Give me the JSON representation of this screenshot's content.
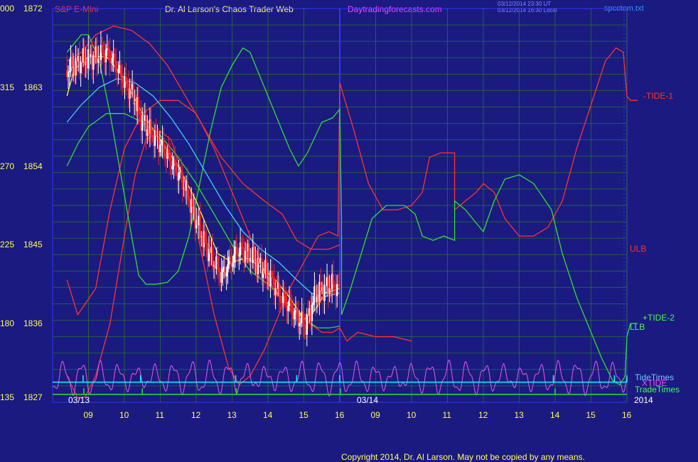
{
  "header": {
    "symbol": "S&P E-Mini",
    "title": "Dr. Al Larson's Chaos Trader Web",
    "site": "Daytradingforecasts.com",
    "timestamp1": "03/12/2014 23:30 UT",
    "timestamp2": "03/12/2014 16:30 Local",
    "filename": "spcctem.txt"
  },
  "copyright": "Copyright 2014, Dr. Al Larson. May not be copied by any means.",
  "colors": {
    "background": "#1a1a80",
    "grid": "#2b7a2b",
    "price_up": "#ffffff",
    "price_down": "#ff2020",
    "tide_red": "#ff3333",
    "tide_green": "#33dd33",
    "ema_cyan": "#44ccff",
    "ema_yellow": "#ffff44",
    "magenta": "#ee55ee",
    "tide_times": "#00ffff",
    "trade_times": "#33dd33",
    "divider": "#3333ff"
  },
  "chart_data": {
    "type": "line",
    "ylim": [
      1827,
      1872
    ],
    "y_ticks": [
      {
        "left": "000",
        "value": "1872"
      },
      {
        "left": "315",
        "value": "1863"
      },
      {
        "left": "270",
        "value": "1854"
      },
      {
        "left": "225",
        "value": "1845"
      },
      {
        "left": "180",
        "value": "1836"
      },
      {
        "left": "135",
        "value": "1827"
      }
    ],
    "x_ticks": [
      "09",
      "10",
      "11",
      "12",
      "13",
      "14",
      "15",
      "16",
      "09",
      "10",
      "11",
      "12",
      "13",
      "14",
      "15",
      "16"
    ],
    "x_hours": [
      9,
      10,
      11,
      12,
      13,
      14,
      15,
      16,
      9,
      10,
      11,
      12,
      13,
      14,
      15,
      16
    ],
    "date_labels": [
      "03/13",
      "03/14"
    ],
    "year": "2014",
    "line_labels": {
      "tide1": "-TIDE-1",
      "ulb": "ULB",
      "tide2": "+TIDE-2",
      "llb": "LLB",
      "tide_times": "TideTimes",
      "xtide": "XTIDE",
      "trade_times": "TradeTimes"
    },
    "series": [
      {
        "key": "upper_red",
        "color": "#ff3333",
        "points": [
          [
            8.4,
            1841
          ],
          [
            8.7,
            1837
          ],
          [
            9.2,
            1840
          ],
          [
            9.6,
            1849
          ],
          [
            10.0,
            1856
          ],
          [
            10.5,
            1860
          ],
          [
            11.0,
            1861.5
          ],
          [
            11.5,
            1861.5
          ],
          [
            12.0,
            1860
          ],
          [
            12.5,
            1856
          ],
          [
            13.0,
            1851
          ],
          [
            13.5,
            1846
          ],
          [
            14.0,
            1841
          ],
          [
            14.5,
            1838
          ],
          [
            15.0,
            1836.5
          ],
          [
            15.5,
            1835
          ],
          [
            15.8,
            1835
          ],
          [
            16.0,
            1835.5
          ],
          [
            16.2,
            1834
          ],
          [
            16.5,
            1835
          ],
          [
            17.0,
            1834.5
          ],
          [
            17.5,
            1834.5
          ],
          [
            18.0,
            1834
          ]
        ]
      },
      {
        "key": "ulb",
        "color": "#ff3333",
        "points": [
          [
            8.4,
            1866
          ],
          [
            8.8,
            1867
          ],
          [
            9.2,
            1869
          ],
          [
            9.7,
            1870
          ],
          [
            10.2,
            1869.5
          ],
          [
            10.7,
            1868
          ],
          [
            11.2,
            1865.5
          ],
          [
            11.7,
            1862
          ],
          [
            12.2,
            1858.5
          ],
          [
            12.7,
            1855
          ],
          [
            13.3,
            1852
          ],
          [
            13.9,
            1850
          ],
          [
            14.4,
            1848.5
          ],
          [
            14.8,
            1845.5
          ],
          [
            15.2,
            1844.5
          ],
          [
            15.7,
            1844.5
          ],
          [
            16.0,
            1845
          ]
        ]
      },
      {
        "key": "tide1_red",
        "color": "#ff3333",
        "points": [
          [
            8.4,
            1830
          ],
          [
            8.7,
            1827.5
          ],
          [
            8.9,
            1827.6
          ],
          [
            9.2,
            1830
          ],
          [
            9.6,
            1836
          ],
          [
            10.0,
            1846
          ],
          [
            10.3,
            1853
          ],
          [
            10.6,
            1857
          ],
          [
            11.0,
            1858
          ],
          [
            11.3,
            1857
          ],
          [
            11.7,
            1852
          ],
          [
            12.1,
            1845
          ],
          [
            12.5,
            1837
          ],
          [
            12.9,
            1831
          ],
          [
            13.2,
            1829
          ],
          [
            13.5,
            1830
          ],
          [
            13.9,
            1833
          ],
          [
            14.3,
            1837
          ],
          [
            14.6,
            1840
          ],
          [
            15.0,
            1843
          ],
          [
            15.4,
            1846
          ],
          [
            15.7,
            1846.5
          ],
          [
            15.95,
            1846
          ],
          [
            16.0,
            1863.5
          ],
          [
            16.4,
            1858
          ],
          [
            16.8,
            1852
          ],
          [
            17.2,
            1849
          ],
          [
            17.6,
            1849
          ],
          [
            18.0,
            1849.5
          ],
          [
            18.3,
            1851
          ],
          [
            18.5,
            1855
          ],
          [
            18.8,
            1855.5
          ],
          [
            19.2,
            1855.5
          ],
          [
            19.2,
            1849
          ],
          [
            19.5,
            1850
          ],
          [
            19.8,
            1851
          ],
          [
            20.0,
            1852
          ],
          [
            20.3,
            1851
          ],
          [
            20.6,
            1848
          ],
          [
            21.0,
            1846
          ],
          [
            21.4,
            1846
          ],
          [
            21.8,
            1847
          ],
          [
            22.2,
            1850
          ],
          [
            22.6,
            1856
          ],
          [
            23.0,
            1861
          ],
          [
            23.4,
            1866
          ],
          [
            23.7,
            1867.5
          ],
          [
            23.9,
            1867
          ],
          [
            24.0,
            1862
          ],
          [
            24.1,
            1861.5
          ],
          [
            24.3,
            1861.5
          ]
        ]
      },
      {
        "key": "tide2_green",
        "color": "#33dd33",
        "points": [
          [
            8.4,
            1867
          ],
          [
            8.6,
            1868
          ],
          [
            8.8,
            1869
          ],
          [
            9.0,
            1869
          ],
          [
            9.3,
            1866
          ],
          [
            9.6,
            1860
          ],
          [
            9.9,
            1853
          ],
          [
            10.2,
            1846
          ],
          [
            10.4,
            1841.5
          ],
          [
            10.6,
            1840.5
          ],
          [
            10.9,
            1840.5
          ],
          [
            11.2,
            1840.7
          ],
          [
            11.5,
            1842
          ],
          [
            11.8,
            1846
          ],
          [
            12.1,
            1852
          ],
          [
            12.4,
            1858
          ],
          [
            12.7,
            1863
          ],
          [
            13.0,
            1865.5
          ],
          [
            13.3,
            1867.5
          ],
          [
            13.5,
            1867
          ],
          [
            13.8,
            1864
          ],
          [
            14.2,
            1860
          ],
          [
            14.6,
            1856
          ],
          [
            14.85,
            1854
          ],
          [
            15.1,
            1855.5
          ],
          [
            15.5,
            1859
          ],
          [
            15.8,
            1859.5
          ],
          [
            16.0,
            1860.5
          ],
          [
            16.05,
            1848
          ],
          [
            16.05,
            1837
          ],
          [
            16.3,
            1840
          ],
          [
            16.6,
            1844
          ],
          [
            16.9,
            1848
          ],
          [
            17.3,
            1849.5
          ],
          [
            17.8,
            1849.5
          ],
          [
            18.1,
            1848.5
          ],
          [
            18.3,
            1846
          ],
          [
            18.6,
            1845.5
          ],
          [
            18.9,
            1846
          ],
          [
            19.2,
            1845.5
          ],
          [
            19.2,
            1850
          ],
          [
            19.5,
            1849
          ],
          [
            19.8,
            1847.5
          ],
          [
            20.0,
            1846.5
          ],
          [
            20.3,
            1850
          ],
          [
            20.6,
            1852.5
          ],
          [
            21.0,
            1853
          ],
          [
            21.4,
            1852
          ],
          [
            21.9,
            1849
          ],
          [
            22.2,
            1844
          ],
          [
            22.6,
            1839
          ],
          [
            23.0,
            1835
          ],
          [
            23.3,
            1832
          ],
          [
            23.6,
            1829.5
          ],
          [
            23.8,
            1829
          ],
          [
            23.95,
            1830
          ],
          [
            24.0,
            1834.5
          ],
          [
            24.1,
            1836
          ],
          [
            24.3,
            1836
          ]
        ]
      },
      {
        "key": "llb",
        "color": "#33dd33",
        "points": [
          [
            8.4,
            1854
          ],
          [
            8.7,
            1856.5
          ],
          [
            9.0,
            1858.5
          ],
          [
            9.5,
            1860
          ],
          [
            10.0,
            1860
          ],
          [
            10.5,
            1859
          ],
          [
            11.0,
            1857.5
          ],
          [
            11.5,
            1855
          ],
          [
            12.0,
            1852
          ],
          [
            12.5,
            1848.5
          ],
          [
            13.0,
            1845
          ],
          [
            13.5,
            1842
          ],
          [
            14.0,
            1840.5
          ],
          [
            14.5,
            1838.5
          ],
          [
            15.0,
            1836.5
          ],
          [
            15.4,
            1835.5
          ],
          [
            15.7,
            1835.5
          ],
          [
            16.0,
            1835.7
          ]
        ]
      },
      {
        "key": "ema_cyan",
        "color": "#44ccff",
        "points": [
          [
            8.4,
            1859
          ],
          [
            8.8,
            1861
          ],
          [
            9.3,
            1863
          ],
          [
            9.8,
            1864
          ],
          [
            10.3,
            1863.5
          ],
          [
            10.8,
            1862
          ],
          [
            11.3,
            1859.5
          ],
          [
            11.8,
            1856.5
          ],
          [
            12.3,
            1853
          ],
          [
            12.8,
            1849.5
          ],
          [
            13.3,
            1846.5
          ],
          [
            13.8,
            1844.5
          ],
          [
            14.3,
            1843
          ],
          [
            14.8,
            1841
          ],
          [
            15.2,
            1839.5
          ],
          [
            15.5,
            1839
          ],
          [
            15.8,
            1839.3
          ],
          [
            16.0,
            1839.5
          ]
        ]
      },
      {
        "key": "ema_yellow",
        "color": "#ffff44",
        "points": [
          [
            8.4,
            1862
          ],
          [
            8.6,
            1865
          ],
          [
            9.0,
            1866.5
          ],
          [
            9.5,
            1866.5
          ],
          [
            10.0,
            1864
          ],
          [
            10.5,
            1860
          ],
          [
            11.0,
            1857
          ],
          [
            11.5,
            1854
          ],
          [
            12.0,
            1850
          ],
          [
            12.3,
            1847
          ],
          [
            12.6,
            1844
          ],
          [
            13.0,
            1843
          ],
          [
            13.4,
            1843.5
          ],
          [
            13.8,
            1842.5
          ],
          [
            14.2,
            1841
          ],
          [
            14.6,
            1839
          ],
          [
            15.0,
            1836.5
          ],
          [
            15.3,
            1837.5
          ],
          [
            15.6,
            1839.5
          ],
          [
            16.0,
            1840
          ]
        ]
      }
    ],
    "price_path": [
      [
        8.4,
        1865
      ],
      [
        8.8,
        1866
      ],
      [
        9.2,
        1866.5
      ],
      [
        9.5,
        1867
      ],
      [
        9.7,
        1866
      ],
      [
        10.0,
        1863.5
      ],
      [
        10.2,
        1862.5
      ],
      [
        10.45,
        1859.5
      ],
      [
        10.7,
        1858
      ],
      [
        11.0,
        1856.5
      ],
      [
        11.3,
        1854.5
      ],
      [
        11.6,
        1852.5
      ],
      [
        11.9,
        1849
      ],
      [
        12.2,
        1845.5
      ],
      [
        12.5,
        1843
      ],
      [
        12.7,
        1841.5
      ],
      [
        12.95,
        1843
      ],
      [
        13.2,
        1844.5
      ],
      [
        13.45,
        1844
      ],
      [
        13.8,
        1842.5
      ],
      [
        14.1,
        1841
      ],
      [
        14.35,
        1839
      ],
      [
        14.6,
        1838
      ],
      [
        14.85,
        1836.5
      ],
      [
        15.05,
        1835.8
      ],
      [
        15.3,
        1839
      ],
      [
        15.55,
        1840
      ],
      [
        15.8,
        1840.5
      ],
      [
        16.0,
        1839.8
      ]
    ],
    "cyan_spikes": [
      8.85,
      10.45,
      13.1,
      14.8,
      16.0,
      21.95,
      23.65,
      24.0
    ],
    "green_spikes": [
      8.87,
      10.5,
      13.12,
      16.02,
      22.0
    ],
    "tide_times_value": 1829.3,
    "trade_times_value": 1827.9,
    "magenta_baseline": 1828.6,
    "divider_hour": 16.0,
    "blue_dashed_hour": 23.92
  }
}
